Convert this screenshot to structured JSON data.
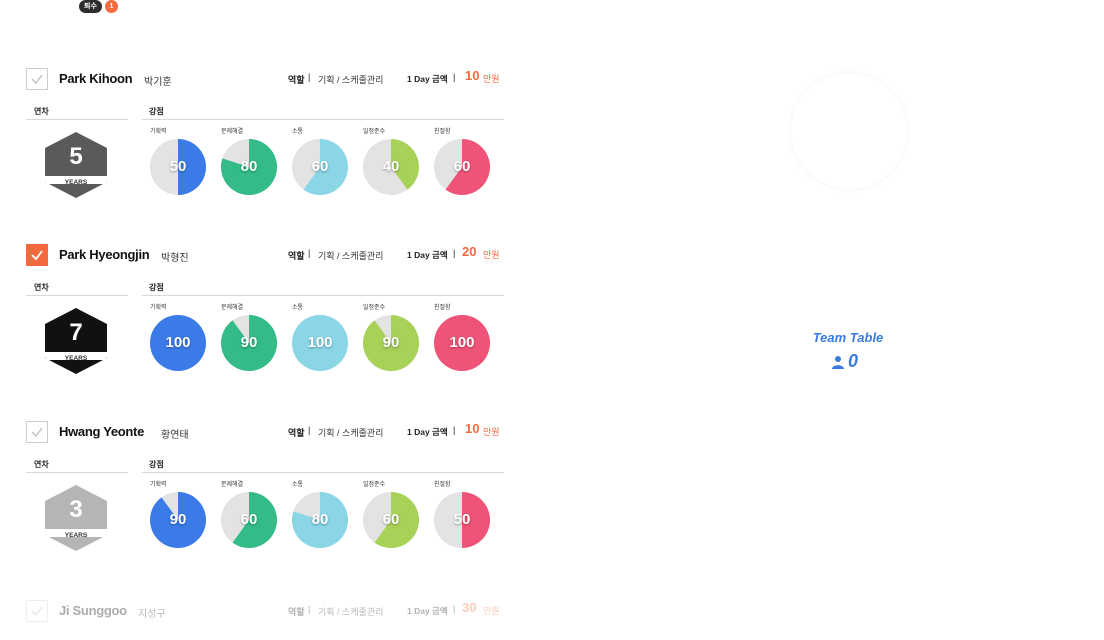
{
  "top_badge": {
    "label": "퇴수",
    "count": "1"
  },
  "labels": {
    "role": "역할",
    "pay": "1 Day 금액",
    "pay_unit": "만원",
    "years_section": "연차",
    "strength_section": "강점",
    "years_word": "YEARS",
    "separator": "|"
  },
  "stat_labels": [
    "기획력",
    "문제해결",
    "소통",
    "일정준수",
    "친절함"
  ],
  "stat_colors": [
    "#3b7be8",
    "#33bb88",
    "#8ad6e6",
    "#a8d157",
    "#ef5478"
  ],
  "members": [
    {
      "name_en": "Park Kihoon",
      "name_kr": "박기훈",
      "role": "기획 / 스케줄관리",
      "pay": "10",
      "years": "5",
      "checked": false,
      "hex_color": "#5a5a5a",
      "stats": [
        50,
        80,
        60,
        40,
        60
      ]
    },
    {
      "name_en": "Park Hyeongjin",
      "name_kr": "박형진",
      "role": "기획 / 스케줄관리",
      "pay": "20",
      "years": "7",
      "checked": true,
      "hex_color": "#111111",
      "stats": [
        100,
        90,
        100,
        90,
        100
      ]
    },
    {
      "name_en": "Hwang Yeonte",
      "name_kr": "황연태",
      "role": "기획 / 스케줄관리",
      "pay": "10",
      "years": "3",
      "checked": false,
      "hex_color": "#b5b5b5",
      "stats": [
        90,
        60,
        80,
        60,
        50
      ]
    },
    {
      "name_en": "Ji Sunggoo",
      "name_kr": "지성구",
      "role": "기획 / 스케줄관리",
      "pay": "30",
      "years": "",
      "checked": false,
      "hex_color": "#b5b5b5",
      "stats": []
    }
  ],
  "team": {
    "title": "Team Table",
    "count": "0"
  }
}
